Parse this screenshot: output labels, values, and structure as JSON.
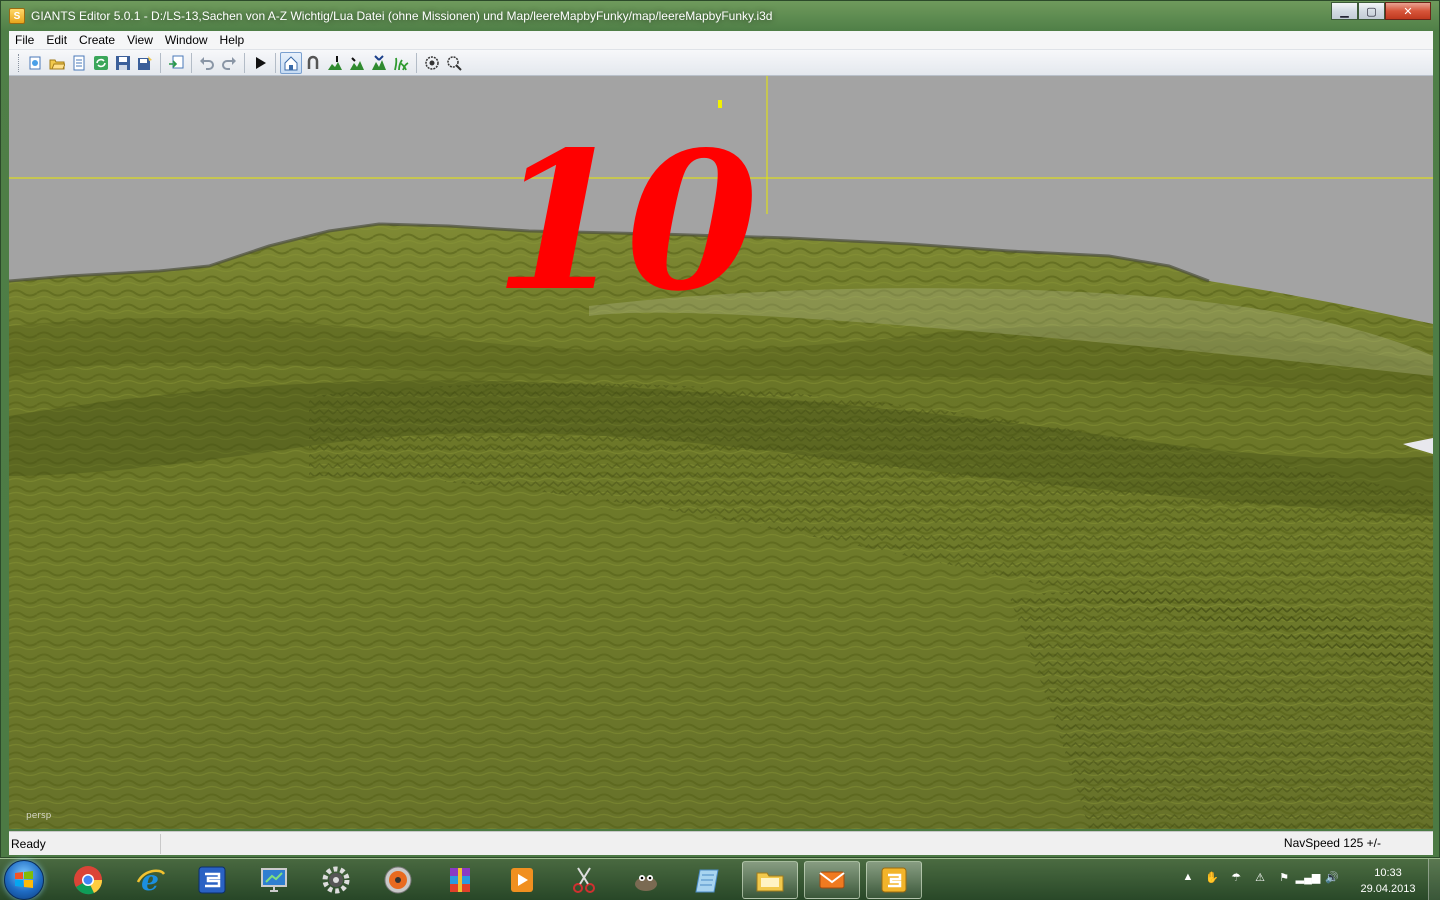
{
  "window": {
    "title": "GIANTS Editor 5.0.1 - D:/LS-13,Sachen von A-Z Wichtig/Lua Datei (ohne Missionen) und Map/leereMapbyFunky/map/leereMapbyFunky.i3d",
    "app_icon": "S",
    "controls": {
      "minimize": "▁",
      "maximize": "▢",
      "close": "✕"
    }
  },
  "menu": {
    "items": [
      "File",
      "Edit",
      "Create",
      "View",
      "Window",
      "Help"
    ]
  },
  "toolbar": {
    "icons": [
      "new-scene-icon",
      "open-icon",
      "properties-icon",
      "reload-icon",
      "save-icon",
      "save-as-icon",
      "import-icon",
      "undo-icon",
      "redo-icon",
      "play-icon",
      "camera-home-icon",
      "magnet-icon",
      "terrain-sculpt-icon",
      "terrain-paint-icon",
      "foliage-icon",
      "grass-paint-icon",
      "selection-mode-icon",
      "select-all-icon"
    ]
  },
  "viewport": {
    "overlay_number": "10",
    "camera_label": "persp",
    "colors": {
      "sky": "#a3a3a3",
      "terrain": "#6f7a2a",
      "overlay": "#ff0000",
      "guide": "#e8e800"
    }
  },
  "status": {
    "left": "Ready",
    "right": "NavSpeed 125 +/-"
  },
  "taskbar": {
    "apps": [
      "start-orb",
      "chrome-icon",
      "internet-explorer-icon",
      "giants-blue-icon",
      "monitor-icon",
      "settings-icon",
      "disc-icon",
      "winrar-icon",
      "media-player-icon",
      "snipping-icon",
      "gimp-icon",
      "notepad-icon",
      "explorer-icon",
      "mail-icon",
      "giants-editor-icon"
    ],
    "clock": {
      "time": "10:33",
      "date": "29.04.2013"
    }
  }
}
